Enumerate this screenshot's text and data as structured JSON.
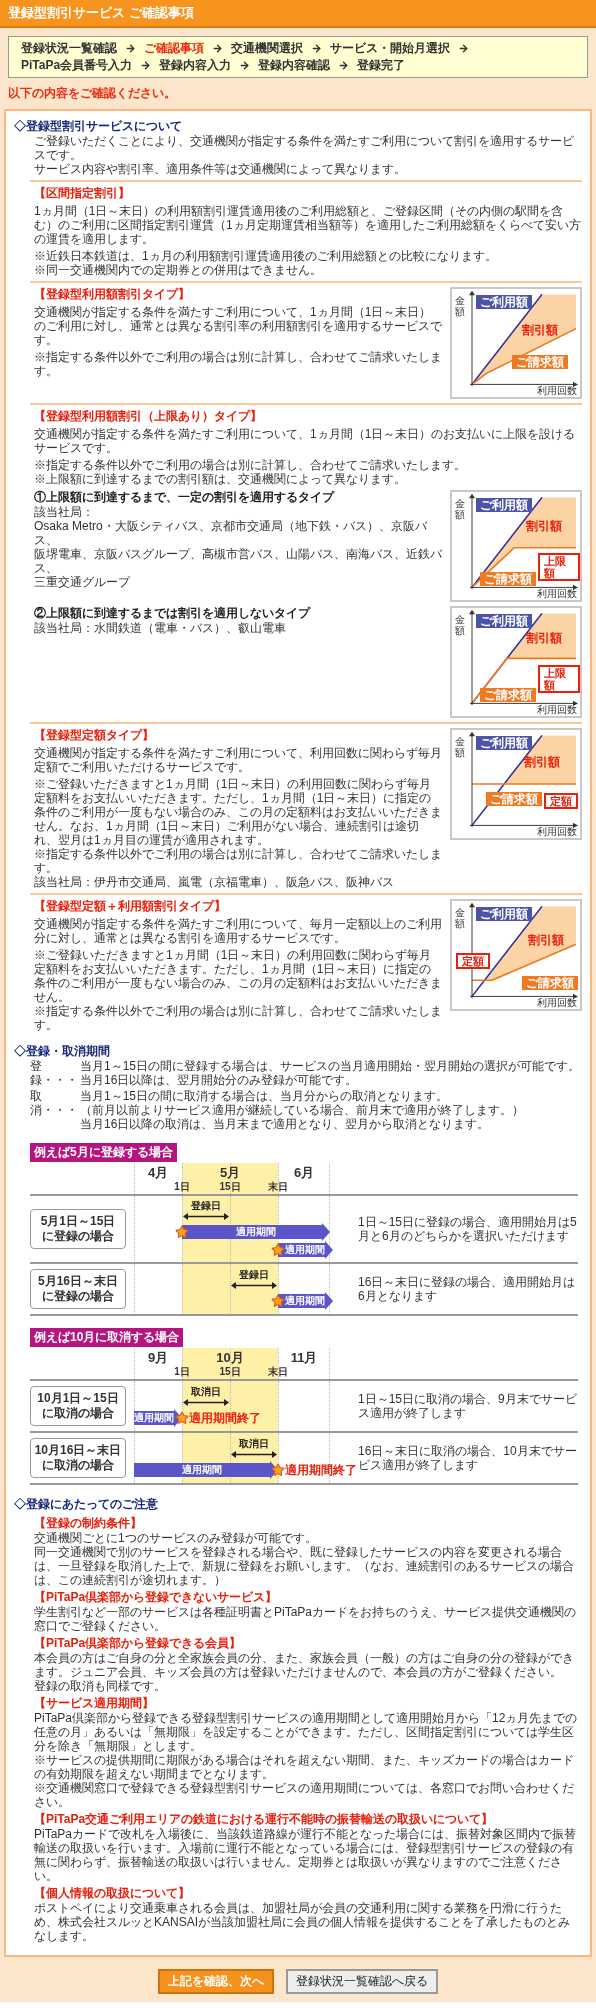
{
  "title": "登録型割引サービス ご確認事項",
  "steps": [
    {
      "label": "登録状況一覧確認",
      "selected": false
    },
    {
      "label": "ご確認事項",
      "selected": true
    },
    {
      "label": "交通機関選択",
      "selected": false
    },
    {
      "label": "サービス・開始月選択",
      "selected": false
    },
    {
      "label": "PiTaPa会員番号入力",
      "selected": false
    },
    {
      "label": "登録内容入力",
      "selected": false
    },
    {
      "label": "登録内容確認",
      "selected": false
    },
    {
      "label": "登録完了",
      "selected": false
    }
  ],
  "notice": "以下の内容をご確認ください。",
  "about": {
    "heading": "◇登録型割引サービスについて",
    "intro": [
      "ご登録いただくことにより、交通機関が指定する条件を満たすご利用について割引を適用するサービスです。",
      "サービス内容や割引率、適用条件等は交通機関によって異なります。"
    ],
    "services": [
      {
        "title": "【区間指定割引】",
        "paragraphs": [
          "1ヵ月間（1日～末日）の利用額割引運賃適用後のご利用総額と、ご登録区間（その内側の駅間を含む）のご利用に区間指定割引運賃（1ヵ月定期運賃相当額等）を適用したご利用総額をくらべて安い方の運賃を適用します。"
        ],
        "notes": [
          "※近鉄日本鉄道は、1ヵ月の利用額割引運賃適用後のご利用総額との比較になります。",
          "※同一交通機関内での定期券との併用はできません。"
        ]
      },
      {
        "title": "【登録型利用額割引タイプ】",
        "paragraphs": [
          "交通機関が指定する条件を満たすご利用について、1ヵ月間（1日～末日）のご利用に対し、通常とは異なる割引率の利用額割引を適用するサービスです。"
        ],
        "notes": [
          "※指定する条件以外でご利用の場合は別に計算し、合わせてご請求いたします。"
        ],
        "diagram": {
          "kind": "usage",
          "y_axis": "金額",
          "x_axis": "利用回数",
          "usage": "ご利用額",
          "discount": "割引額",
          "billed": "ご請求額"
        }
      },
      {
        "title": "【登録型利用額割引（上限あり）タイプ】",
        "paragraphs": [
          "交通機関が指定する条件を満たすご利用について、1ヵ月間（1日～末日）のお支払いに上限を設けるサービスです。"
        ],
        "notes": [
          "※指定する条件以外でご利用の場合は別に計算し、合わせてご請求いたします。",
          "※上限額に到達するまでの割引額は、交通機関によって異なります。"
        ],
        "subtypes": [
          {
            "title": "①上限額に到達するまで、一定の割引を適用するタイプ",
            "operators": [
              "該当社局：",
              "Osaka Metro・大阪シティバス、京都市交通局（地下鉄・バス）、京阪バス、",
              "阪堺電車、京阪バスグループ、高槻市営バス、山陽バス、南海バス、近鉄バス、",
              "三重交通グループ"
            ],
            "diagram": {
              "kind": "cap",
              "y_axis": "金額",
              "x_axis": "利用回数",
              "usage": "ご利用額",
              "discount": "割引額",
              "billed": "ご請求額",
              "marker": "上限額"
            }
          },
          {
            "title": "②上限額に到達するまでは割引を適用しないタイプ",
            "operators": [
              "該当社局：水間鉄道（電車・バス）、叡山電車"
            ],
            "diagram": {
              "kind": "cap_after",
              "y_axis": "金額",
              "x_axis": "利用回数",
              "usage": "ご利用額",
              "discount": "割引額",
              "billed": "ご請求額",
              "marker": "上限額"
            }
          }
        ]
      },
      {
        "title": "【登録型定額タイプ】",
        "paragraphs": [
          "交通機関が指定する条件を満たすご利用について、利用回数に関わらず毎月定額でご利用いただけるサービスです。"
        ],
        "notes": [
          "※ご登録いただきますと1ヵ月間（1日～末日）の利用回数に関わらず毎月定額料をお支払いいただきます。ただし、1ヵ月間（1日～末日）に指定の条件のご利用が一度もない場合のみ、この月の定額料はお支払いいただきません。なお、1ヵ月間（1日～末日）ご利用がない場合、連続割引は途切れ、翌月は1ヵ月目の運賃が適用されます。",
          "※指定する条件以外でご利用の場合は別に計算し、合わせてご請求いたします。",
          "該当社局：伊丹市交通局、嵐電（京福電車）、阪急バス、阪神バス"
        ],
        "diagram": {
          "kind": "flat",
          "y_axis": "金額",
          "x_axis": "利用回数",
          "usage": "ご利用額",
          "discount": "割引額",
          "billed": "ご請求額",
          "marker": "定額"
        }
      },
      {
        "title": "【登録型定額＋利用額割引タイプ】",
        "paragraphs": [
          "交通機関が指定する条件を満たすご利用について、毎月一定額以上のご利用分に対し、通常とは異なる割引を適用するサービスです。"
        ],
        "notes": [
          "※ご登録いただきますと1ヵ月間（1日～末日）の利用回数に関わらず毎月定額料をお支払いいただきます。ただし、1ヵ月間（1日～末日）に指定の条件のご利用が一度もない場合のみ、この月の定額料はお支払いいただきません。",
          "※指定する条件以外でご利用の場合は別に計算し、合わせてご請求いたします。"
        ],
        "diagram": {
          "kind": "flat_plus",
          "y_axis": "金額",
          "x_axis": "利用回数",
          "usage": "ご利用額",
          "discount": "割引額",
          "billed": "ご請求額",
          "marker": "定額"
        }
      }
    ]
  },
  "period": {
    "heading": "◇登録・取消期間",
    "items": [
      {
        "term": "登録・・・",
        "lines": [
          "当月1～15日の間に登録する場合は、サービスの当月適用開始・翌月開始の選択が可能です。",
          "当月16日以降は、翌月開始分のみ登録が可能です。"
        ]
      },
      {
        "term": "取消・・・",
        "lines": [
          "当月1～15日の間に取消する場合は、当月分からの取消となります。",
          "（前月以前よりサービス適用が継続している場合、前月末で適用が終了します。）",
          "当月16日以降の取消は、当月末まで適用となり、翌月から取消となります。"
        ]
      }
    ],
    "examples": [
      {
        "title": "例えば5月に登録する場合",
        "months": [
          "4月",
          "5月",
          "6月"
        ],
        "days": [
          "1日",
          "15日",
          "末日"
        ],
        "rows": [
          {
            "kind": "reg_first",
            "case": [
              "5月1日～15日",
              "に登録の場合"
            ],
            "span": "登録日",
            "periods": [
              "適用期間",
              "適用期間"
            ],
            "description": "1日～15日に登録の場合、適用開始月は5月と6月のどちらかを選択いただけます"
          },
          {
            "kind": "reg_second",
            "case": [
              "5月16日～末日",
              "に登録の場合"
            ],
            "span": "登録日",
            "periods": [
              "適用期間"
            ],
            "description": "16日～末日に登録の場合、適用開始月は6月となります"
          }
        ]
      },
      {
        "title": "例えば10月に取消する場合",
        "months": [
          "9月",
          "10月",
          "11月"
        ],
        "days": [
          "1日",
          "15日",
          "末日"
        ],
        "rows": [
          {
            "kind": "cancel_first",
            "case": [
              "10月1日～15日",
              "に取消の場合"
            ],
            "span": "取消日",
            "periods": [
              "適用期間"
            ],
            "end": "適用期間終了",
            "description": "1日～15日に取消の場合、9月末でサービス適用が終了します"
          },
          {
            "kind": "cancel_second",
            "case": [
              "10月16日～末日",
              "に取消の場合"
            ],
            "span": "取消日",
            "periods": [
              "適用期間"
            ],
            "end": "適用期間終了",
            "description": "16日～末日に取消の場合、10月末でサービス適用が終了します"
          }
        ]
      }
    ]
  },
  "cautions": {
    "heading": "◇登録にあたってのご注意",
    "items": [
      {
        "title": "【登録の制約条件】",
        "lines": [
          "交通機関ごとに1つのサービスのみ登録が可能です。",
          "同一交通機関で別のサービスを登録される場合や、既に登録したサービスの内容を変更される場合は、一旦登録を取消した上で、新規に登録をお願いします。（なお、連続割引のあるサービスの場合は、この連続割引が途切れます。）"
        ]
      },
      {
        "title": "【PiTaPa倶楽部から登録できないサービス】",
        "lines": [
          "学生割引など一部のサービスは各種証明書とPiTaPaカードをお持ちのうえ、サービス提供交通機関の窓口でご登録ください。"
        ]
      },
      {
        "title": "【PiTaPa倶楽部から登録できる会員】",
        "lines": [
          "本会員の方はご自身の分と全家族会員の分、また、家族会員（一般）の方はご自身の分の登録ができます。ジュニア会員、キッズ会員の方は登録いただけませんので、本会員の方がご登録ください。",
          "登録の取消も同様です。"
        ]
      },
      {
        "title": "【サービス適用期間】",
        "lines": [
          "PiTaPa倶楽部から登録できる登録型割引サービスの適用期間として適用開始月から「12ヵ月先までの任意の月」あるいは「無期限」を設定することができます。ただし、区間指定割引については学生区分を除き「無期限」とします。",
          "※サービスの提供期間に期限がある場合はそれを超えない期間、また、キッズカードの場合はカードの有効期限を超えない期間までとなります。",
          "※交通機関窓口で登録できる登録型割引サービスの適用期間については、各窓口でお問い合わせください。"
        ]
      },
      {
        "title": "【PiTaPa交通ご利用エリアの鉄道における運行不能時の振替輸送の取扱いについて】",
        "lines": [
          "PiTaPaカードで改札を入場後に、当該鉄道路線が運行不能となった場合には、振替対象区間内で振替輸送の取扱いを行います。入場前に運行不能となっている場合には、登録型割引サービスの登録の有無に関わらず、振替輸送の取扱いは行いません。定期券とは取扱いが異なりますのでご注意ください。"
        ]
      },
      {
        "title": "【個人情報の取扱について】",
        "lines": [
          "ポストペイにより交通乗車される会員は、加盟社局が会員の交通利用に関する業務を円滑に行うため、株式会社スルッとKANSAIが当該加盟社局に会員の個人情報を提供することを了承したものとみなします。"
        ]
      }
    ]
  },
  "buttons": [
    {
      "label": "上記を確認、次へ",
      "kind": "primary"
    },
    {
      "label": "登録状況一覧確認へ戻る",
      "kind": "secondary"
    }
  ]
}
